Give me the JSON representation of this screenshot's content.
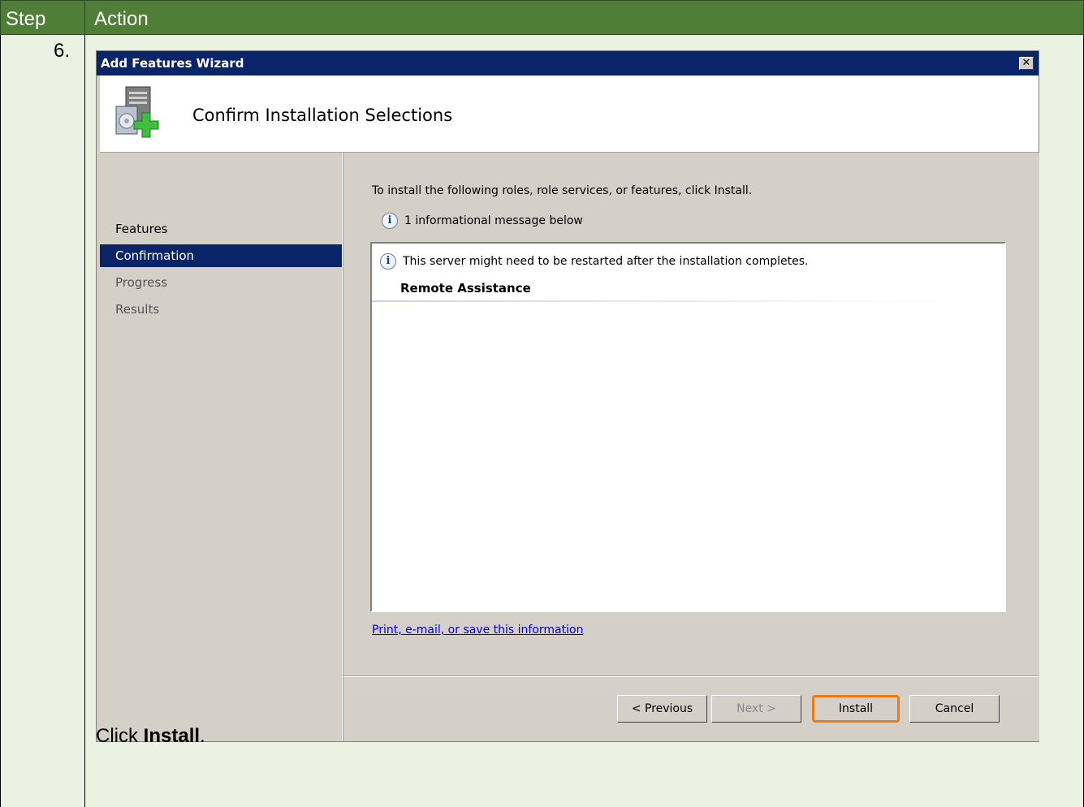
{
  "table": {
    "header_step": "Step",
    "header_action": "Action",
    "step_number": "6.",
    "instruction_prefix": "Click ",
    "instruction_bold": "Install",
    "instruction_suffix": "."
  },
  "wizard": {
    "title": "Add Features Wizard",
    "close_glyph": "✕",
    "page_heading": "Confirm Installation Selections",
    "nav": [
      "Features",
      "Confirmation",
      "Progress",
      "Results"
    ],
    "intro": "To install the following roles, role services, or features, click Install.",
    "info_summary": "1 informational message below",
    "info_message": "This server might need to be restarted after the installation completes.",
    "feature_name": "Remote Assistance",
    "link": "Print, e-mail, or save this information",
    "buttons": {
      "previous": "< Previous",
      "next": "Next >",
      "install": "Install",
      "cancel": "Cancel"
    }
  },
  "colors": {
    "header_green": "#4f7f37",
    "row_bg": "#ecf2e1",
    "titlebar": "#0a246a",
    "highlight": "#f07a10"
  },
  "icons": {
    "banner": "server-add-icon",
    "info": "info-icon"
  }
}
